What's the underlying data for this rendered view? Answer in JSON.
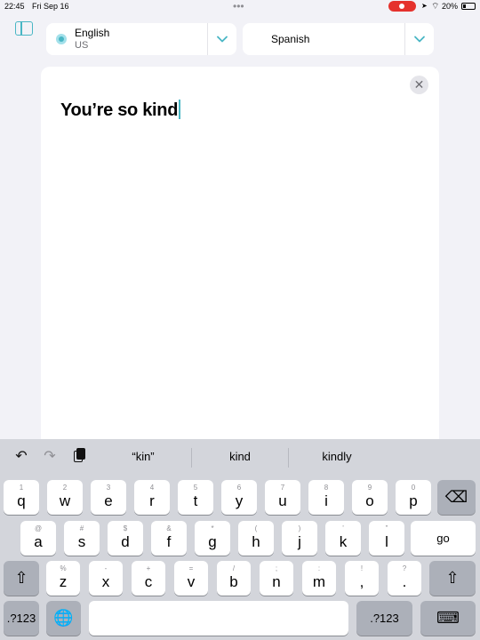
{
  "status": {
    "time": "22:45",
    "date": "Fri Sep 16",
    "battery": "20%",
    "dots": "•••"
  },
  "source_lang": {
    "name": "English",
    "region": "US"
  },
  "target_lang": {
    "name": "Spanish"
  },
  "input": {
    "text": "You’re so kind"
  },
  "close_glyph": "✕",
  "suggestions": [
    "“kin”",
    "kind",
    "kindly"
  ],
  "keyboard": {
    "row1": [
      {
        "hint": "1",
        "key": "q"
      },
      {
        "hint": "2",
        "key": "w"
      },
      {
        "hint": "3",
        "key": "e"
      },
      {
        "hint": "4",
        "key": "r"
      },
      {
        "hint": "5",
        "key": "t"
      },
      {
        "hint": "6",
        "key": "y"
      },
      {
        "hint": "7",
        "key": "u"
      },
      {
        "hint": "8",
        "key": "i"
      },
      {
        "hint": "9",
        "key": "o"
      },
      {
        "hint": "0",
        "key": "p"
      }
    ],
    "row2": [
      {
        "hint": "@",
        "key": "a"
      },
      {
        "hint": "#",
        "key": "s"
      },
      {
        "hint": "$",
        "key": "d"
      },
      {
        "hint": "&",
        "key": "f"
      },
      {
        "hint": "*",
        "key": "g"
      },
      {
        "hint": "(",
        "key": "h"
      },
      {
        "hint": ")",
        "key": "j"
      },
      {
        "hint": "’",
        "key": "k"
      },
      {
        "hint": "”",
        "key": "l"
      }
    ],
    "row3": [
      {
        "hint": "%",
        "key": "z"
      },
      {
        "hint": "-",
        "key": "x"
      },
      {
        "hint": "+",
        "key": "c"
      },
      {
        "hint": "=",
        "key": "v"
      },
      {
        "hint": "/",
        "key": "b"
      },
      {
        "hint": ";",
        "key": "n"
      },
      {
        "hint": ":",
        "key": "m"
      },
      {
        "hint": "!",
        "key": ","
      },
      {
        "hint": "?",
        "key": "."
      }
    ],
    "go_label": "go",
    "numbers_label": ".?123",
    "icons": {
      "undo": "↶",
      "redo": "↷",
      "delete": "⌫",
      "shift": "⇧",
      "globe": "🌐",
      "hide_keyboard": "⌨"
    }
  }
}
